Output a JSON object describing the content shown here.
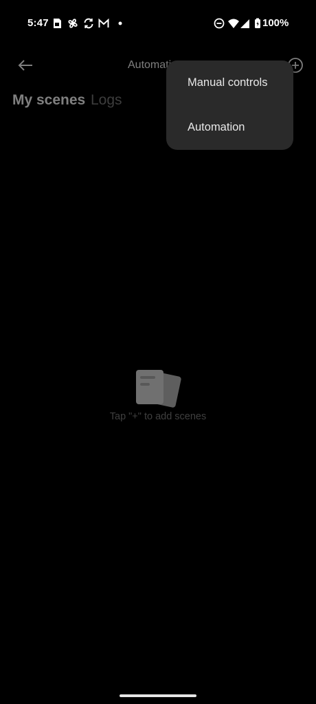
{
  "status_bar": {
    "time": "5:47",
    "battery": "100%",
    "icons": [
      "sim-card-icon",
      "fan-icon",
      "sync-icon",
      "gmail-icon",
      "notification-dot-icon",
      "do-not-disturb-icon",
      "wifi-icon",
      "signal-icon",
      "battery-icon"
    ]
  },
  "app_bar": {
    "title": "Automation",
    "back_icon": "back-arrow-icon",
    "add_icon": "add-circle-icon"
  },
  "tabs": [
    {
      "label": "My scenes",
      "active": true
    },
    {
      "label": "Logs",
      "active": false
    }
  ],
  "empty_state": {
    "icon": "scenes-cards-icon",
    "message": "Tap \"+\" to add scenes"
  },
  "popup_menu": {
    "items": [
      {
        "label": "Manual controls"
      },
      {
        "label": "Automation"
      }
    ]
  },
  "colors": {
    "background": "#000000",
    "popup_background": "#2a2a2a",
    "inactive_tab": "#7a7a7a",
    "muted_text": "#7e7e7e"
  }
}
